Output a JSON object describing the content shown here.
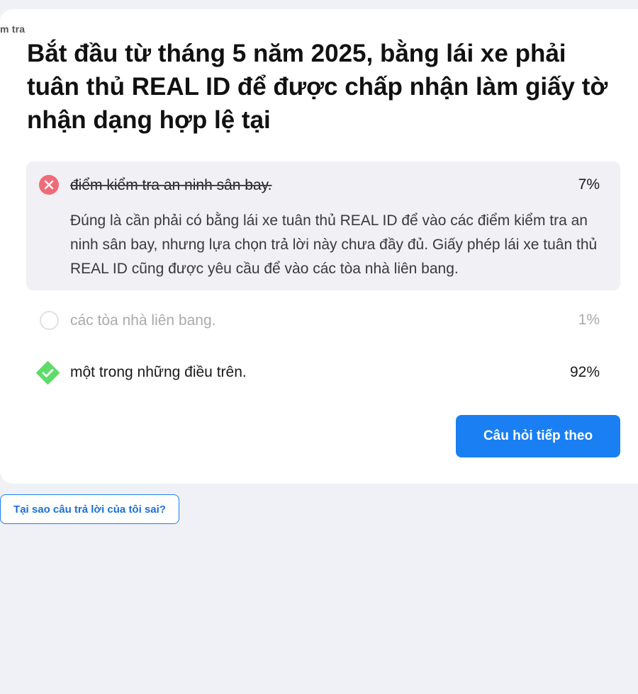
{
  "header": {
    "cut_label": "m tra"
  },
  "question": {
    "text": "Bắt đầu từ tháng 5 năm 2025, bằng lái xe phải tuân thủ REAL ID để được chấp nhận làm giấy tờ nhận dạng hợp lệ tại"
  },
  "answers": [
    {
      "label": "điểm kiểm tra an ninh sân bay.",
      "percent": "7%",
      "state": "wrong",
      "icon": "x-circle-icon",
      "explanation": "Đúng là cần phải có bằng lái xe tuân thủ REAL ID để vào các điểm kiểm tra an ninh sân bay, nhưng lựa chọn trả lời này chưa đầy đủ. Giấy phép lái xe tuân thủ REAL ID cũng được yêu cầu để vào các tòa nhà liên bang."
    },
    {
      "label": "các tòa nhà liên bang.",
      "percent": "1%",
      "state": "neutral",
      "icon": "empty-circle-icon"
    },
    {
      "label": "một trong những điều trên.",
      "percent": "92%",
      "state": "correct",
      "icon": "check-diamond-icon"
    }
  ],
  "buttons": {
    "next_label": "Câu hỏi tiếp theo",
    "why_label": "Tại sao câu trả lời của tôi sai?"
  },
  "colors": {
    "accent": "#1a7ff2",
    "wrong": "#f06a78",
    "correct": "#5ddc6a",
    "background": "#f0f1f6"
  }
}
